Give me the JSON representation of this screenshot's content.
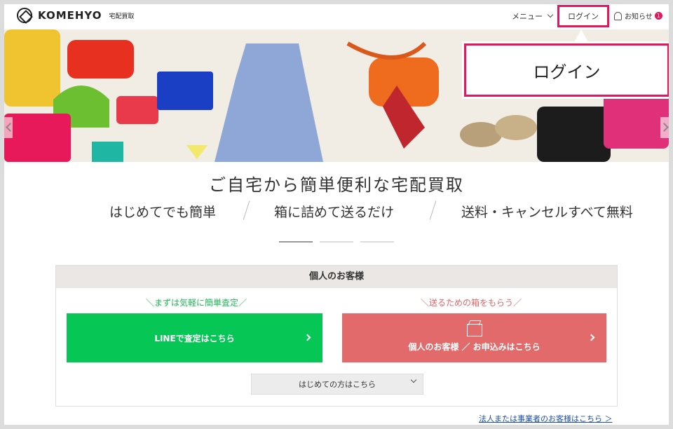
{
  "header": {
    "brand": "KOMEHYO",
    "brand_sub": "宅配買取",
    "menu_label": "メニュー",
    "login_label": "ログイン",
    "notice_label": "お知らせ",
    "notice_count": "1"
  },
  "callout": {
    "label": "ログイン"
  },
  "hero": {
    "products": [
      "yellow-tote",
      "red-bag",
      "green-bag",
      "blue-bag",
      "pink-wallet",
      "dress",
      "orange-bag",
      "scarf",
      "sandals",
      "black-bag",
      "pink-bag",
      "yellow-envelope",
      "teal-card"
    ]
  },
  "tagline": {
    "title": "ご自宅から簡単便利な宅配買取",
    "features": [
      "はじめてでも簡単",
      "箱に詰めて送るだけ",
      "送料・キャンセルすべて無料"
    ]
  },
  "card": {
    "heading": "個人のお客様",
    "line_sub": "＼まずは気軽に簡単査定／",
    "line_button": "LINEで査定はこちら",
    "box_sub": "＼送るための箱をもらう／",
    "box_button": "個人のお客様 ／ お申込みはこちら",
    "select_label": "はじめての方はこちら"
  },
  "corporate_link": "法人または事業者のお客様はこちら ＞",
  "colors": {
    "accent": "#e3175b",
    "line_green": "#06c755",
    "box_red": "#e36a6a",
    "link_blue": "#1a4fa0"
  }
}
